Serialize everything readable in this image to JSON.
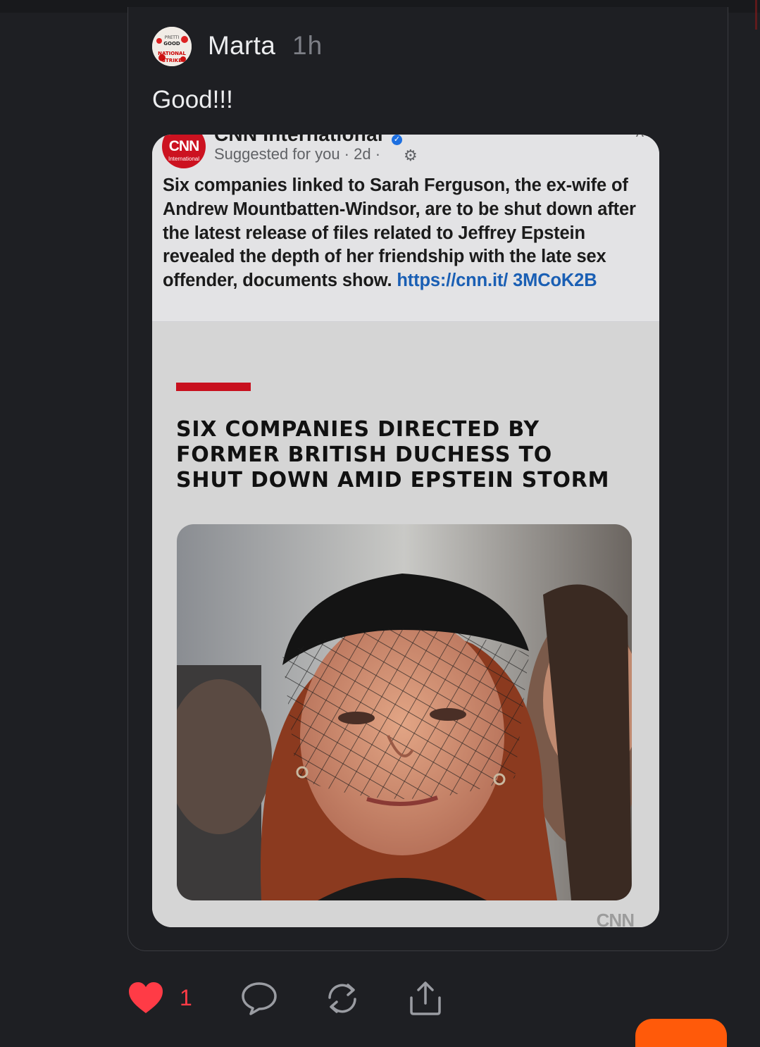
{
  "post": {
    "author": "Marta",
    "time": "1h",
    "text": "Good!!!",
    "avatar_text": [
      "PRETTI",
      "GOOD",
      "NATIONAL",
      "STRIKE"
    ]
  },
  "embedded": {
    "source": "CNN International",
    "logo_text": "CNN",
    "logo_sub": "International",
    "meta": "Suggested for you · 2d ·",
    "caption": "Six companies linked to Sarah Ferguson, the ex-wife of Andrew Mountbatten-Windsor, are to be shut down after the latest release of files related to Jeffrey Epstein revealed the depth of her friendship with the late sex offender, documents show.",
    "link": "https://cnn.it/ 3MCoK2B",
    "headline_lines": [
      "SIX COMPANIES DIRECTED BY",
      "FORMER BRITISH DUCHESS TO",
      "SHUT DOWN AMID EPSTEIN STORM"
    ],
    "watermark": "CNN"
  },
  "actions": {
    "like_count": "1",
    "icons": [
      "heart-icon",
      "comment-icon",
      "repost-icon",
      "share-icon"
    ]
  },
  "colors": {
    "background": "#1e1f23",
    "like": "#ff3b46",
    "cnn_red": "#c8101e",
    "accent_orange": "#ff5a0a",
    "link": "#1a5fb4"
  }
}
